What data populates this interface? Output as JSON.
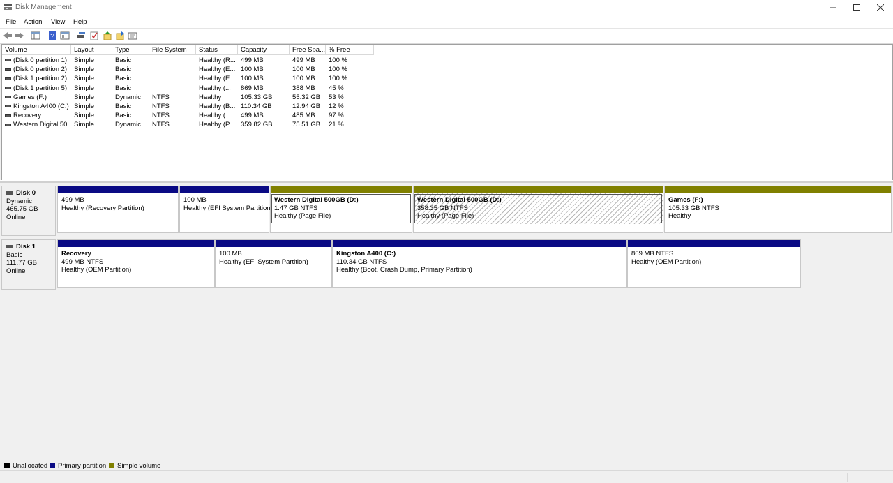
{
  "window": {
    "title": "Disk Management"
  },
  "menu": [
    "File",
    "Action",
    "View",
    "Help"
  ],
  "toolbar_icons": [
    "back-icon",
    "forward-icon",
    "show-hide-console-tree-icon",
    "help-icon",
    "properties-icon",
    "connect-icon",
    "check-icon",
    "up-icon",
    "export-icon",
    "settings-icon"
  ],
  "volume_list": {
    "columns": [
      "Volume",
      "Layout",
      "Type",
      "File System",
      "Status",
      "Capacity",
      "Free Spa...",
      "% Free"
    ],
    "rows": [
      [
        "(Disk 0 partition 1)",
        "Simple",
        "Basic",
        "",
        "Healthy (R...",
        "499 MB",
        "499 MB",
        "100 %"
      ],
      [
        "(Disk 0 partition 2)",
        "Simple",
        "Basic",
        "",
        "Healthy (E...",
        "100 MB",
        "100 MB",
        "100 %"
      ],
      [
        "(Disk 1 partition 2)",
        "Simple",
        "Basic",
        "",
        "Healthy (E...",
        "100 MB",
        "100 MB",
        "100 %"
      ],
      [
        "(Disk 1 partition 5)",
        "Simple",
        "Basic",
        "",
        "Healthy (...",
        "869 MB",
        "388 MB",
        "45 %"
      ],
      [
        "Games (F:)",
        "Simple",
        "Dynamic",
        "NTFS",
        "Healthy",
        "105.33 GB",
        "55.32 GB",
        "53 %"
      ],
      [
        "Kingston A400 (C:)",
        "Simple",
        "Basic",
        "NTFS",
        "Healthy (B...",
        "110.34 GB",
        "12.94 GB",
        "12 %"
      ],
      [
        "Recovery",
        "Simple",
        "Basic",
        "NTFS",
        "Healthy (...",
        "499 MB",
        "485 MB",
        "97 %"
      ],
      [
        "Western Digital 50...",
        "Simple",
        "Dynamic",
        "NTFS",
        "Healthy (P...",
        "359.82 GB",
        "75.51 GB",
        "21 %"
      ]
    ]
  },
  "disks": [
    {
      "name": "Disk 0",
      "type": "Dynamic",
      "size": "465.75 GB",
      "status": "Online",
      "partitions": [
        {
          "name": "",
          "size": "499 MB",
          "status": "Healthy (Recovery Partition)",
          "kind": "primary"
        },
        {
          "name": "",
          "size": "100 MB",
          "status": "Healthy (EFI System Partition",
          "kind": "primary"
        },
        {
          "name": "Western Digital 500GB  (D:)",
          "size": "1.47 GB NTFS",
          "status": "Healthy (Page File)",
          "kind": "simple"
        },
        {
          "name": "Western Digital 500GB  (D:)",
          "size": "358.35 GB NTFS",
          "status": "Healthy (Page File)",
          "kind": "simple"
        },
        {
          "name": "Games  (F:)",
          "size": "105.33 GB NTFS",
          "status": "Healthy",
          "kind": "simple"
        }
      ]
    },
    {
      "name": "Disk 1",
      "type": "Basic",
      "size": "111.77 GB",
      "status": "Online",
      "partitions": [
        {
          "name": "Recovery",
          "size": "499 MB NTFS",
          "status": "Healthy (OEM Partition)",
          "kind": "primary"
        },
        {
          "name": "",
          "size": "100 MB",
          "status": "Healthy (EFI System Partition)",
          "kind": "primary"
        },
        {
          "name": "Kingston A400  (C:)",
          "size": "110.34 GB NTFS",
          "status": "Healthy (Boot, Crash Dump, Primary Partition)",
          "kind": "primary"
        },
        {
          "name": "",
          "size": "869 MB NTFS",
          "status": "Healthy (OEM Partition)",
          "kind": "primary"
        }
      ]
    }
  ],
  "legend": [
    {
      "label": "Unallocated",
      "color": "#000000"
    },
    {
      "label": "Primary partition",
      "color": "#0a0a84"
    },
    {
      "label": "Simple volume",
      "color": "#808000"
    }
  ],
  "colors": {
    "primary": "#0a0a84",
    "simple": "#808000",
    "unallocated": "#000000"
  }
}
